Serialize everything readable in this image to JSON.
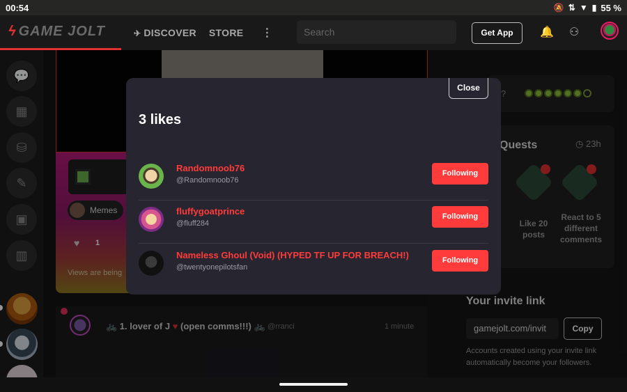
{
  "status_bar": {
    "time": "00:54",
    "battery": "55 %"
  },
  "nav": {
    "logo": "GAME JOLT",
    "discover": "DISCOVER",
    "store": "STORE",
    "more": "⋮",
    "search_placeholder": "Search",
    "get_app": "Get App"
  },
  "feed": {
    "memes_chip": "Memes",
    "like_count": "1",
    "views_text": "Views are being",
    "post2_name_prefix": "🚲 1. lover of J",
    "post2_heart": "♥",
    "post2_name_suffix": " (open comms!!!) 🚲",
    "post2_handle": "@rranci",
    "post2_time": "1 minute"
  },
  "right": {
    "quests_title": "Quests",
    "quests_time": "23h",
    "quest_like_label": "Like 20 posts",
    "quest_react_label": "React to 5 different comments",
    "invite_title": "Your invite link",
    "invite_value": "gamejolt.com/invit",
    "copy_label": "Copy",
    "invite_desc": "Accounts created using your invite link automatically become your followers."
  },
  "modal": {
    "close_label": "Close",
    "title": "3 likes",
    "likers": [
      {
        "name": "Randomnoob76",
        "handle": "@Randomnoob76",
        "button": "Following"
      },
      {
        "name": "fluffygoatprince",
        "handle": "@fluff284",
        "button": "Following"
      },
      {
        "name": "Nameless Ghoul (Void) (HYPED TF UP FOR BREACH!)",
        "handle": "@twentyonepilotsfan",
        "button": "Following"
      }
    ]
  },
  "colors": {
    "accent": "#ff3b3b",
    "modal_bg": "#272630"
  }
}
